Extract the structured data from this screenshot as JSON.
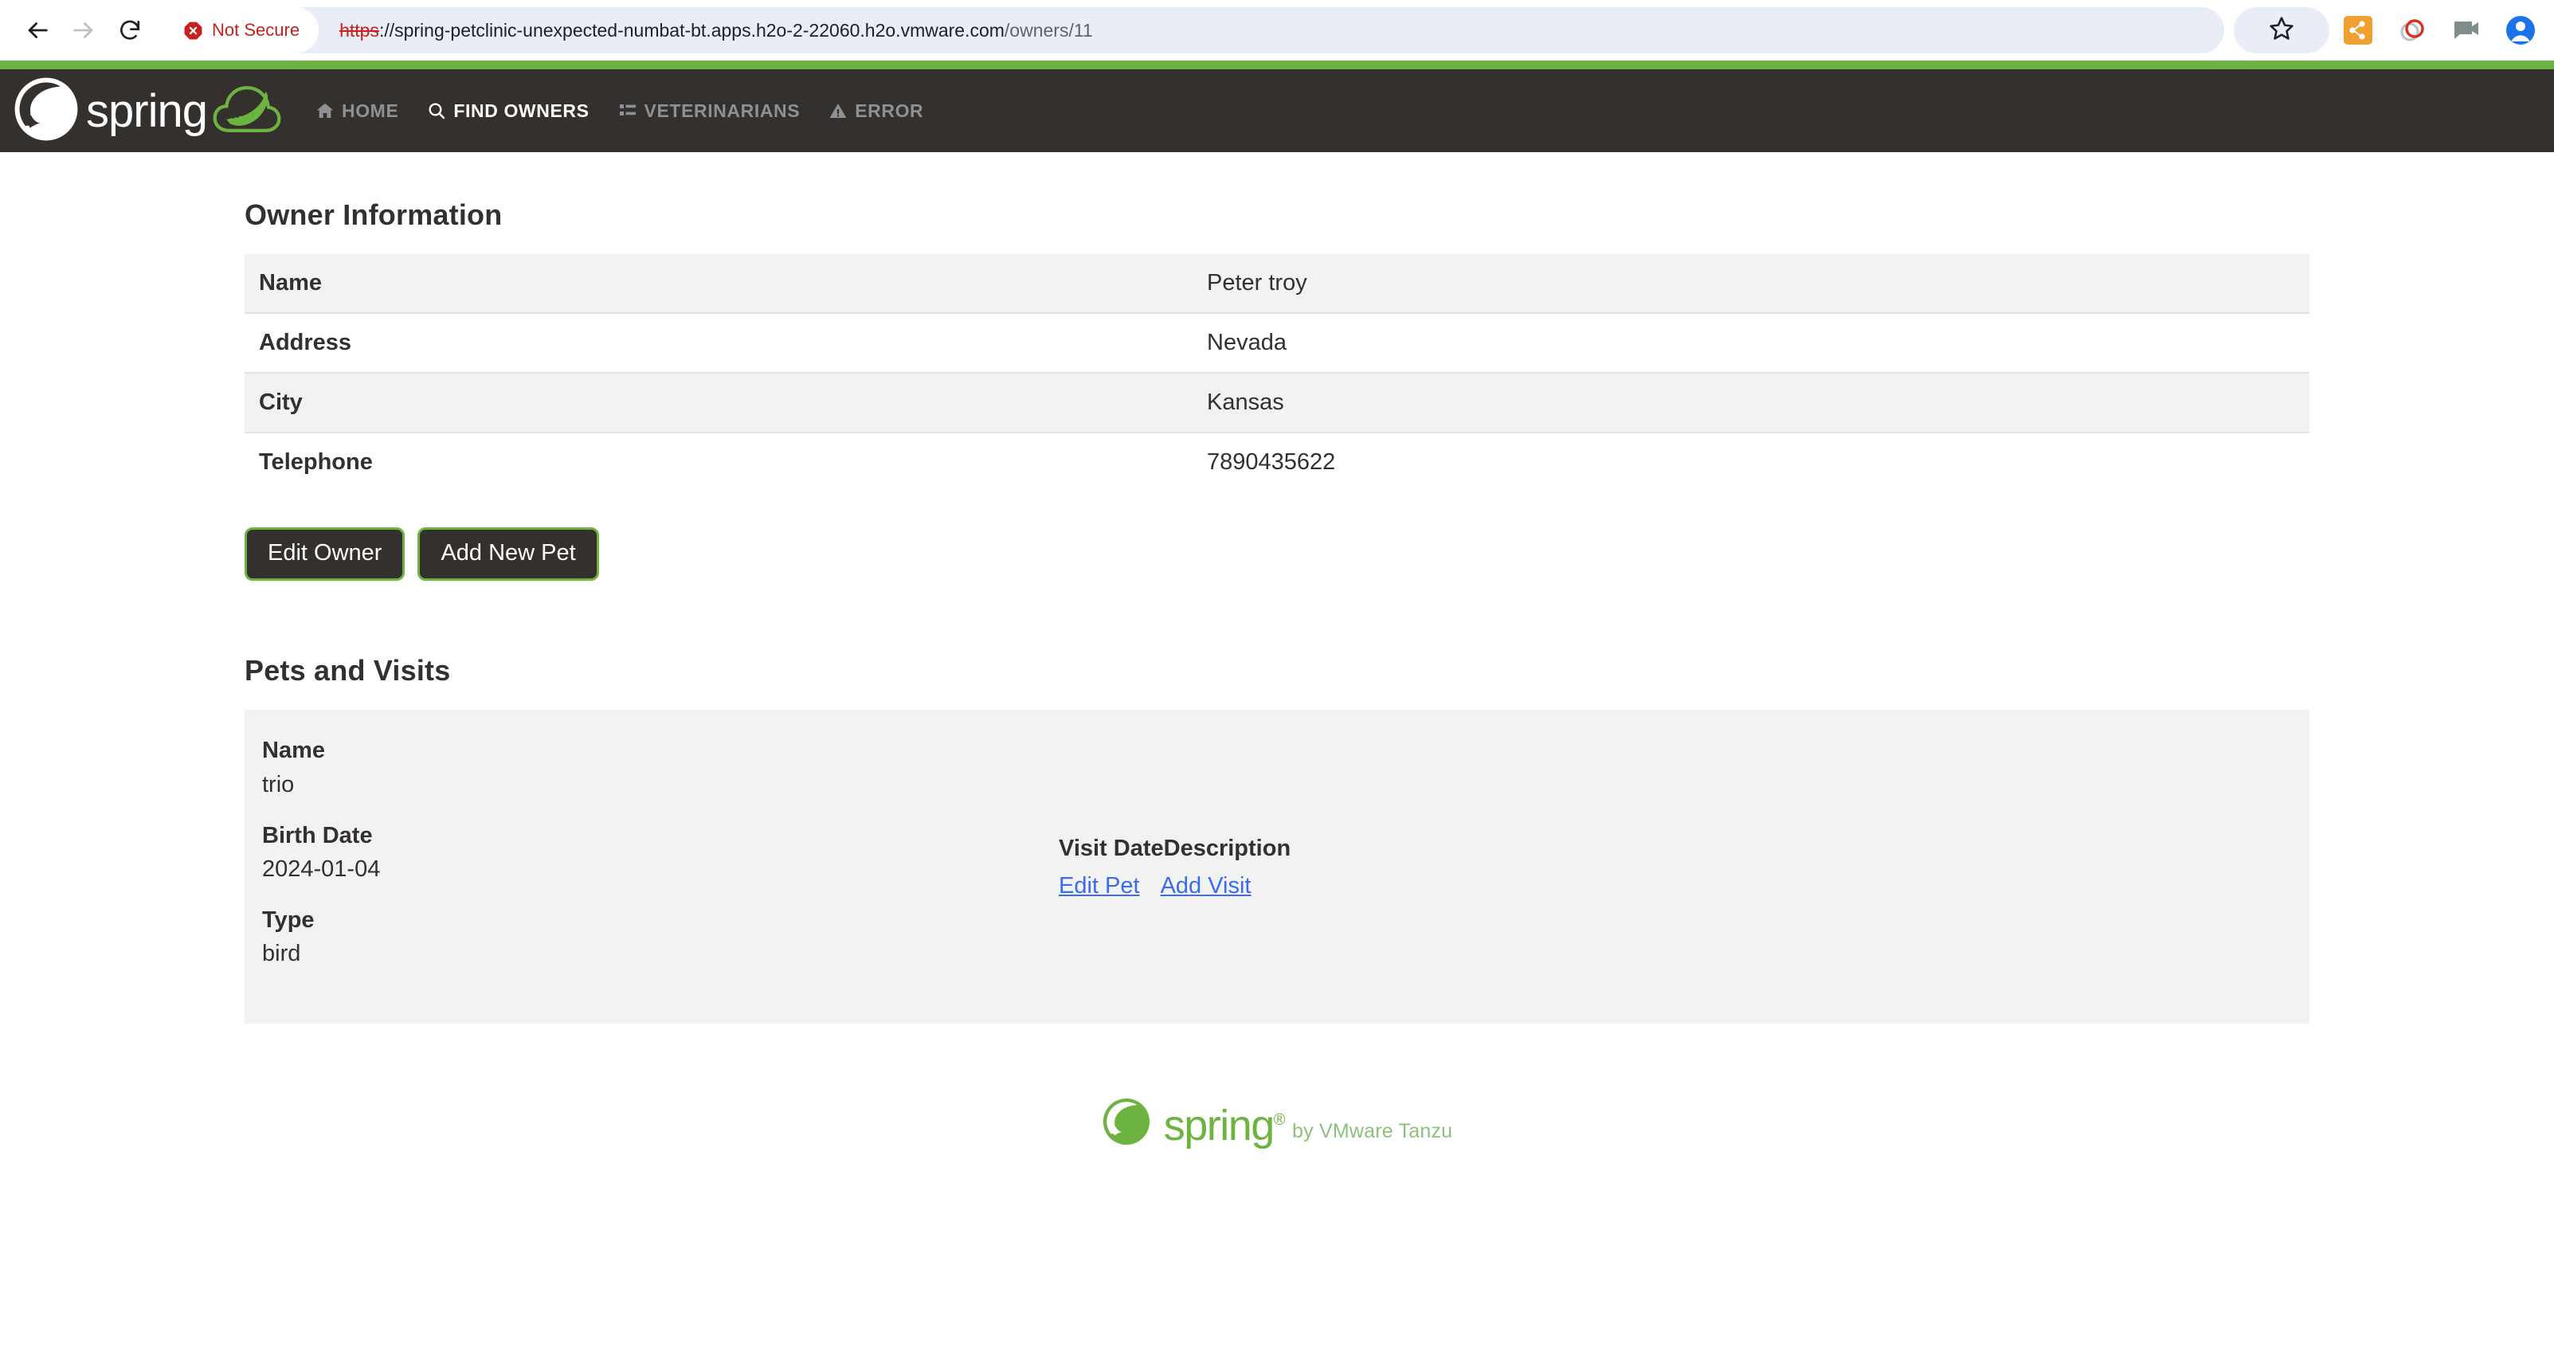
{
  "browser": {
    "back_icon": "back-arrow-icon",
    "forward_icon": "forward-arrow-icon",
    "reload_icon": "reload-icon",
    "security_badge": "Not Secure",
    "security_icon": "not-secure-octagon-icon",
    "url_scheme": "https",
    "url_separator": "://",
    "url_host": "spring-petclinic-unexpected-numbat-bt.apps.h2o-2-22060.h2o.vmware.com",
    "url_path": "/owners/11",
    "bookmark_icon": "star-icon",
    "extensions": [
      {
        "name": "share-extension-icon",
        "color": "#f0a030"
      },
      {
        "name": "recorder-extension-icon",
        "color": "#d93025"
      },
      {
        "name": "video-extension-icon",
        "color": "#7f8c8d"
      },
      {
        "name": "profile-avatar-icon",
        "color": "#1a73e8"
      }
    ]
  },
  "header": {
    "accent_color": "#6db33f",
    "background_color": "#34302d",
    "brand_word": "spring",
    "brand_logo_icon": "spring-leaf-logo-icon",
    "petclinic_badge_icon": "petclinic-cloud-leaf-icon",
    "nav": [
      {
        "label": "HOME",
        "icon": "home-icon",
        "active": false
      },
      {
        "label": "FIND OWNERS",
        "icon": "search-icon",
        "active": true
      },
      {
        "label": "VETERINARIANS",
        "icon": "list-icon",
        "active": false
      },
      {
        "label": "ERROR",
        "icon": "warning-triangle-icon",
        "active": false
      }
    ]
  },
  "owner_section": {
    "title": "Owner Information",
    "rows": [
      {
        "label": "Name",
        "value": "Peter troy"
      },
      {
        "label": "Address",
        "value": "Nevada"
      },
      {
        "label": "City",
        "value": "Kansas"
      },
      {
        "label": "Telephone",
        "value": "7890435622"
      }
    ],
    "buttons": [
      {
        "label": "Edit Owner",
        "name": "edit-owner-button"
      },
      {
        "label": "Add New Pet",
        "name": "add-new-pet-button"
      }
    ]
  },
  "pets_section": {
    "title": "Pets and Visits",
    "pet": {
      "name_label": "Name",
      "name_value": "trio",
      "birth_date_label": "Birth Date",
      "birth_date_value": "2024-01-04",
      "type_label": "Type",
      "type_value": "bird"
    },
    "visits": {
      "headers": [
        "Visit Date",
        "Description"
      ],
      "rows": [],
      "links": [
        {
          "label": "Edit Pet",
          "name": "edit-pet-link"
        },
        {
          "label": "Add Visit",
          "name": "add-visit-link"
        }
      ]
    }
  },
  "footer": {
    "brand_word": "spring",
    "registered_mark": "®",
    "tagline": "by VMware Tanzu",
    "logo_icon": "spring-leaf-logo-green-icon",
    "color": "#6db33f"
  }
}
